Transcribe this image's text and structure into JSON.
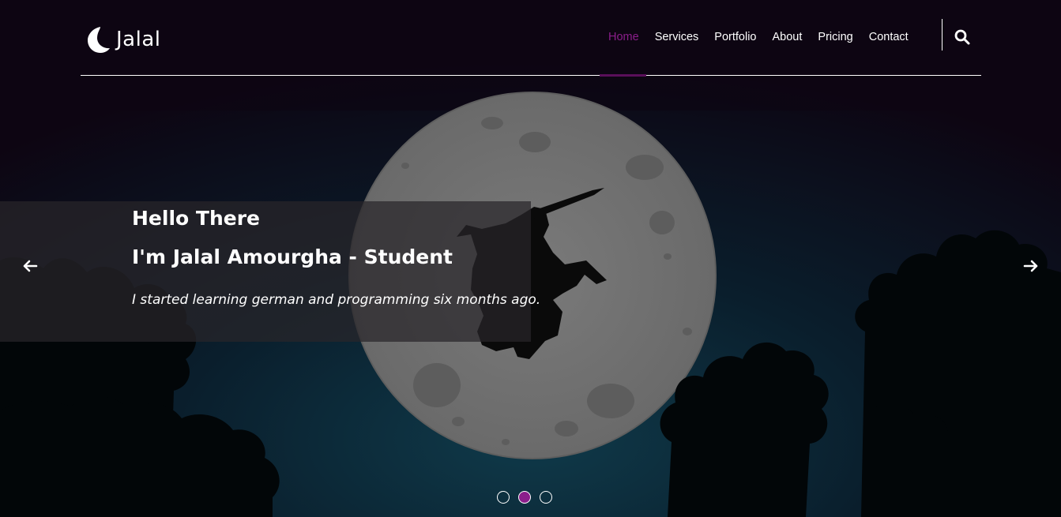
{
  "brand": {
    "name": "Jalal",
    "icon": "crescent-moon-icon"
  },
  "nav": {
    "items": [
      {
        "label": "Home",
        "active": true
      },
      {
        "label": "Services",
        "active": false
      },
      {
        "label": "Portfolio",
        "active": false
      },
      {
        "label": "About",
        "active": false
      },
      {
        "label": "Pricing",
        "active": false
      },
      {
        "label": "Contact",
        "active": false
      }
    ],
    "search_icon": "search-icon"
  },
  "carousel": {
    "title": "Hello There",
    "subtitle": "I'm Jalal Amourgha - Student",
    "text": "I started learning german and programming six months ago.",
    "prev_icon": "arrow-left-icon",
    "next_icon": "arrow-right-icon",
    "indicator_count": 3,
    "active_indicator": 2
  },
  "colors": {
    "accent": "#8b1e8b",
    "background": "#0d0512",
    "text": "#ffffff"
  }
}
